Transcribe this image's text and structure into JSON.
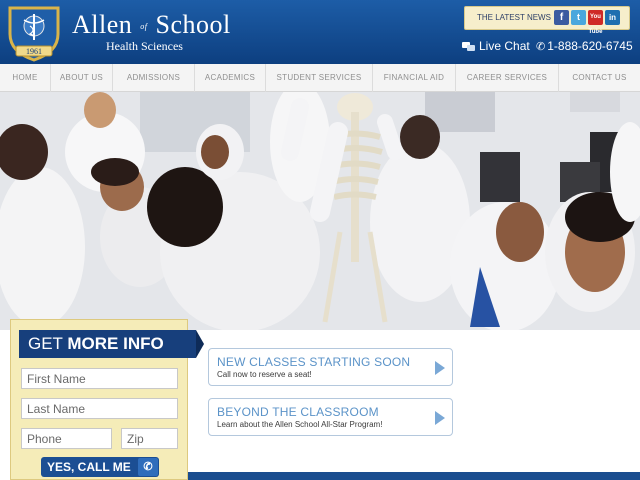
{
  "header": {
    "logo": {
      "year": "1961"
    },
    "brand_name_a": "Allen",
    "brand_of": "of",
    "brand_name_b": "School",
    "brand_sub": "Health Sciences",
    "latest_news": "THE LATEST NEWS",
    "social": [
      "f",
      "t",
      "You Tube",
      "in"
    ],
    "live_chat": "Live Chat",
    "phone": "1-888-620-6745"
  },
  "nav": {
    "items": [
      "HOME",
      "ABOUT US",
      "ADMISSIONS",
      "ACADEMICS",
      "STUDENT SERVICES",
      "FINANCIAL AID",
      "CAREER SERVICES",
      "CONTACT US"
    ]
  },
  "form": {
    "title_light": "GET ",
    "title_bold": "MORE INFO",
    "first_name_placeholder": "First Name",
    "last_name_placeholder": "Last Name",
    "phone_placeholder": "Phone",
    "zip_placeholder": "Zip",
    "submit_label": "YES, CALL ME"
  },
  "promos": [
    {
      "title": "NEW CLASSES STARTING SOON",
      "sub": "Call now to reserve a seat!"
    },
    {
      "title": "BEYOND THE CLASSROOM",
      "sub": "Learn about the Allen School All-Star Program!"
    }
  ],
  "colors": {
    "brand_blue": "#0d3f80",
    "accent_gold": "#f5ecb8",
    "promo_blue": "#5b93c8"
  },
  "icons": {
    "chat": "chat-icon",
    "phone": "phone-icon",
    "arrow": "chevron-right-icon"
  }
}
